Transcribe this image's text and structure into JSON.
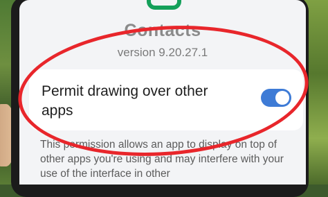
{
  "app": {
    "title": "Contacts",
    "version": "version 9.20.27.1",
    "icon": "contacts-app-icon"
  },
  "permission": {
    "label": "Permit drawing over other apps",
    "enabled": true,
    "description": "This permission allows an app to display on top of other apps you're using and may interfere with your use of the interface in other"
  },
  "colors": {
    "toggle_on": "#3e7bd6",
    "highlight": "#e8262b",
    "icon_green": "#14a05a"
  }
}
